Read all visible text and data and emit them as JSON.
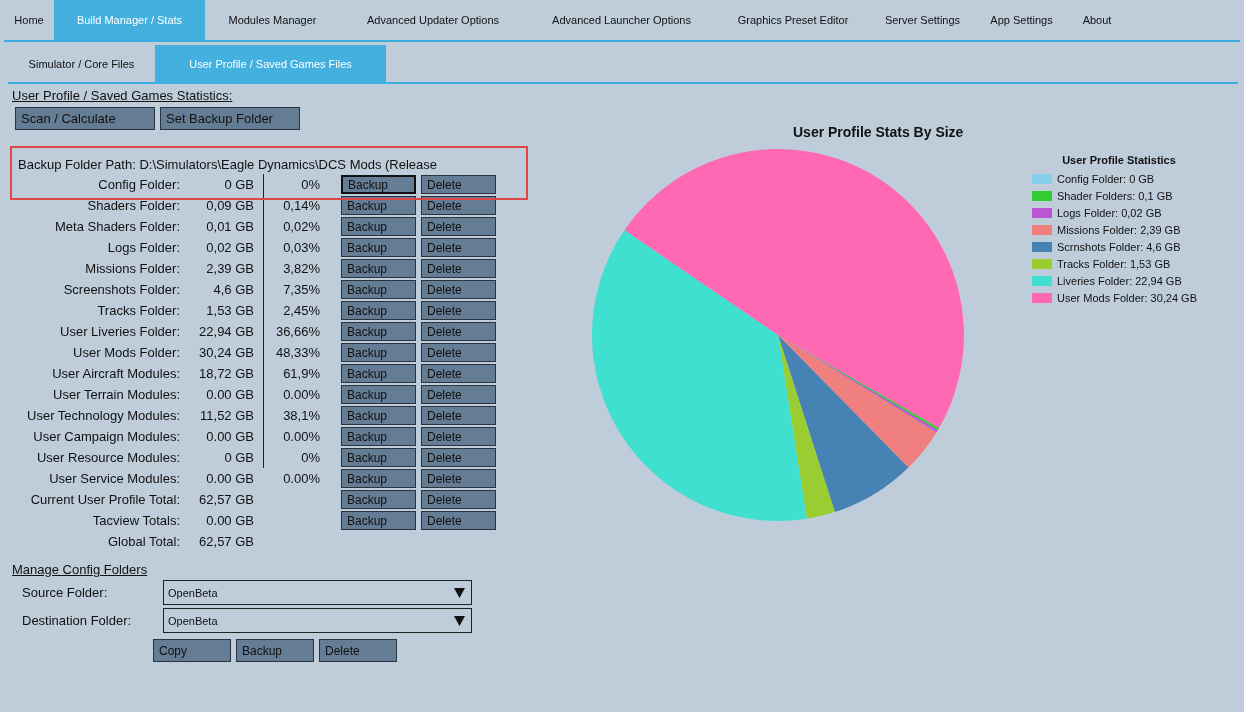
{
  "main_tabs": [
    {
      "label": "Home",
      "selected": false
    },
    {
      "label": "Build Manager / Stats",
      "selected": true
    },
    {
      "label": "Modules Manager",
      "selected": false
    },
    {
      "label": "Advanced Updater Options",
      "selected": false
    },
    {
      "label": "Advanced Launcher Options",
      "selected": false
    },
    {
      "label": "Graphics Preset Editor",
      "selected": false
    },
    {
      "label": "Server Settings",
      "selected": false
    },
    {
      "label": "App Settings",
      "selected": false
    },
    {
      "label": "About",
      "selected": false
    }
  ],
  "sub_tabs": [
    {
      "label": "Simulator / Core Files",
      "selected": false
    },
    {
      "label": "User Profile / Saved Games Files",
      "selected": true
    }
  ],
  "stats": {
    "heading": "User Profile / Saved Games Statistics:",
    "buttons": [
      "Scan / Calculate",
      "Set Backup Folder"
    ],
    "backup_path": "Backup Folder Path: D:\\Simulators\\Eagle Dynamics\\DCS Mods (Release",
    "rows": [
      {
        "label": "Config Folder:",
        "size": "0 GB",
        "percent": "0%",
        "divider": true,
        "buttons": [
          {
            "label": "Backup",
            "focused": true
          },
          {
            "label": "Delete",
            "focused": false
          }
        ]
      },
      {
        "label": "Shaders Folder:",
        "size": "0,09 GB",
        "percent": "0,14%",
        "divider": true,
        "buttons": [
          {
            "label": "Backup",
            "focused": false
          },
          {
            "label": "Delete",
            "focused": false
          }
        ]
      },
      {
        "label": "Meta Shaders Folder:",
        "size": "0,01 GB",
        "percent": "0,02%",
        "divider": true,
        "buttons": [
          {
            "label": "Backup",
            "focused": false
          },
          {
            "label": "Delete",
            "focused": false
          }
        ]
      },
      {
        "label": "Logs Folder:",
        "size": "0,02 GB",
        "percent": "0,03%",
        "divider": true,
        "buttons": [
          {
            "label": "Backup",
            "focused": false
          },
          {
            "label": "Delete",
            "focused": false
          }
        ]
      },
      {
        "label": "Missions Folder:",
        "size": "2,39 GB",
        "percent": "3,82%",
        "divider": true,
        "buttons": [
          {
            "label": "Backup",
            "focused": false
          },
          {
            "label": "Delete",
            "focused": false
          }
        ]
      },
      {
        "label": "Screenshots Folder:",
        "size": "4,6 GB",
        "percent": "7,35%",
        "divider": true,
        "buttons": [
          {
            "label": "Backup",
            "focused": false
          },
          {
            "label": "Delete",
            "focused": false
          }
        ]
      },
      {
        "label": "Tracks Folder:",
        "size": "1,53 GB",
        "percent": "2,45%",
        "divider": true,
        "buttons": [
          {
            "label": "Backup",
            "focused": false
          },
          {
            "label": "Delete",
            "focused": false
          }
        ]
      },
      {
        "label": "User Liveries Folder:",
        "size": "22,94 GB",
        "percent": "36,66%",
        "divider": true,
        "buttons": [
          {
            "label": "Backup",
            "focused": false
          },
          {
            "label": "Delete",
            "focused": false
          }
        ]
      },
      {
        "label": "User Mods Folder:",
        "size": "30,24 GB",
        "percent": "48,33%",
        "divider": true,
        "buttons": [
          {
            "label": "Backup",
            "focused": false
          },
          {
            "label": "Delete",
            "focused": false
          }
        ]
      },
      {
        "label": "User Aircraft Modules:",
        "size": "18,72 GB",
        "percent": "61,9%",
        "divider": true,
        "buttons": [
          {
            "label": "Backup",
            "focused": false
          },
          {
            "label": "Delete",
            "focused": false
          }
        ]
      },
      {
        "label": "User Terrain Modules:",
        "size": "0.00 GB",
        "percent": "0.00%",
        "divider": true,
        "buttons": [
          {
            "label": "Backup",
            "focused": false
          },
          {
            "label": "Delete",
            "focused": false
          }
        ]
      },
      {
        "label": "User Technology Modules:",
        "size": "11,52 GB",
        "percent": "38,1%",
        "divider": true,
        "buttons": [
          {
            "label": "Backup",
            "focused": false
          },
          {
            "label": "Delete",
            "focused": false
          }
        ]
      },
      {
        "label": "User Campaign Modules:",
        "size": "0.00 GB",
        "percent": "0.00%",
        "divider": true,
        "buttons": [
          {
            "label": "Backup",
            "focused": false
          },
          {
            "label": "Delete",
            "focused": false
          }
        ]
      },
      {
        "label": "User Resource Modules:",
        "size": "0 GB",
        "percent": "0%",
        "divider": true,
        "buttons": [
          {
            "label": "Backup",
            "focused": false
          },
          {
            "label": "Delete",
            "focused": false
          }
        ]
      },
      {
        "label": "User Service Modules:",
        "size": "0.00 GB",
        "percent": "0.00%",
        "divider": false,
        "buttons": [
          {
            "label": "Backup",
            "focused": false
          },
          {
            "label": "Delete",
            "focused": false
          }
        ]
      },
      {
        "label": "Current User Profile Total:",
        "size": "62,57 GB",
        "divider": false,
        "buttons": [
          {
            "label": "Backup",
            "focused": false
          },
          {
            "label": "Delete",
            "focused": false
          }
        ]
      },
      {
        "label": "Tacview Totals:",
        "size": "0.00 GB",
        "divider": false,
        "buttons": [
          {
            "label": "Backup",
            "focused": false
          },
          {
            "label": "Delete",
            "focused": false
          }
        ]
      },
      {
        "label": "Global Total:",
        "size": "62,57 GB",
        "divider": false
      }
    ]
  },
  "manage": {
    "heading": "Manage Config Folders",
    "fields": [
      {
        "label": "Source Folder:",
        "value": "OpenBeta"
      },
      {
        "label": "Destination Folder:",
        "value": "OpenBeta"
      }
    ],
    "buttons": [
      "Copy",
      "Backup",
      "Delete"
    ]
  },
  "chart": {
    "chart_data": {
      "type": "pie",
      "title": "User Profile Stats By Size",
      "categories": [
        "Config Folder: 0 GB",
        "Shader Folders: 0,1 GB",
        "Logs Folder: 0,02 GB",
        "Missions Folder: 2,39 GB",
        "Scrnshots Folder: 4,6 GB",
        "Tracks Folder: 1,53 GB",
        "Liveries Folder: 22,94 GB",
        "User Mods Folder: 30,24 GB"
      ],
      "series": [
        {
          "name": "User Profile Statistics",
          "values": [
            null,
            0.1,
            0.02,
            2.39,
            4.6,
            1.53,
            22.94,
            30.24
          ]
        }
      ]
    },
    "legend_items": [
      {
        "color": "#87ceeb"
      },
      {
        "color": "#32cd32"
      },
      {
        "color": "#ba55d3"
      },
      {
        "color": "#f08080"
      },
      {
        "color": "#4682b4"
      },
      {
        "color": "#9acd32"
      },
      {
        "color": "#40e0d0"
      },
      {
        "color": "#ff69b4"
      }
    ]
  }
}
